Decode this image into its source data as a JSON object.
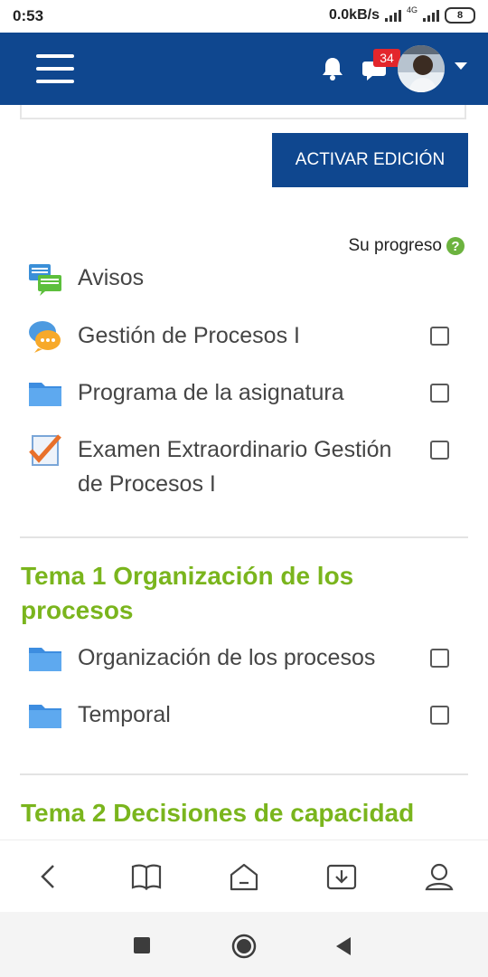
{
  "status_bar": {
    "time": "0:53",
    "net_speed": "0.0kB/s",
    "network_type": "4G",
    "battery": "8"
  },
  "navbar": {
    "menu_icon": "hamburger-menu-icon",
    "bell_icon": "bell-icon",
    "messages_icon": "chat-bubble-icon",
    "message_count": "34",
    "avatar": "user-avatar",
    "dropdown_icon": "caret-down-icon",
    "bg_color": "#0f478f"
  },
  "edit_button": {
    "label": "ACTIVAR EDICIÓN"
  },
  "progress": {
    "label": "Su progreso",
    "help_icon": "?"
  },
  "activities_top": [
    {
      "title": "Avisos",
      "icon": "forum-icon"
    },
    {
      "title": "Gestión de Procesos I",
      "icon": "chat-icon"
    },
    {
      "title": "Programa de la asignatura",
      "icon": "folder-icon"
    },
    {
      "title": "Examen Extraordinario Gestión de Procesos I",
      "icon": "quiz-icon"
    }
  ],
  "sections": [
    {
      "title": "Tema 1 Organización de los procesos",
      "activities": [
        {
          "title": "Organización de los procesos",
          "icon": "folder-icon"
        },
        {
          "title": "Temporal",
          "icon": "folder-icon"
        }
      ]
    },
    {
      "title": "Tema 2 Decisiones de capacidad",
      "activities": []
    }
  ],
  "browser_bar": {
    "icons": [
      "back-icon",
      "book-icon",
      "home-icon",
      "download-icon",
      "profile-icon"
    ]
  },
  "system_nav": {
    "icons": [
      "recents-icon",
      "home-circle-icon",
      "back-triangle-icon"
    ]
  },
  "colors": {
    "accent_green": "#7ab51d",
    "brand_blue": "#0f478f"
  }
}
